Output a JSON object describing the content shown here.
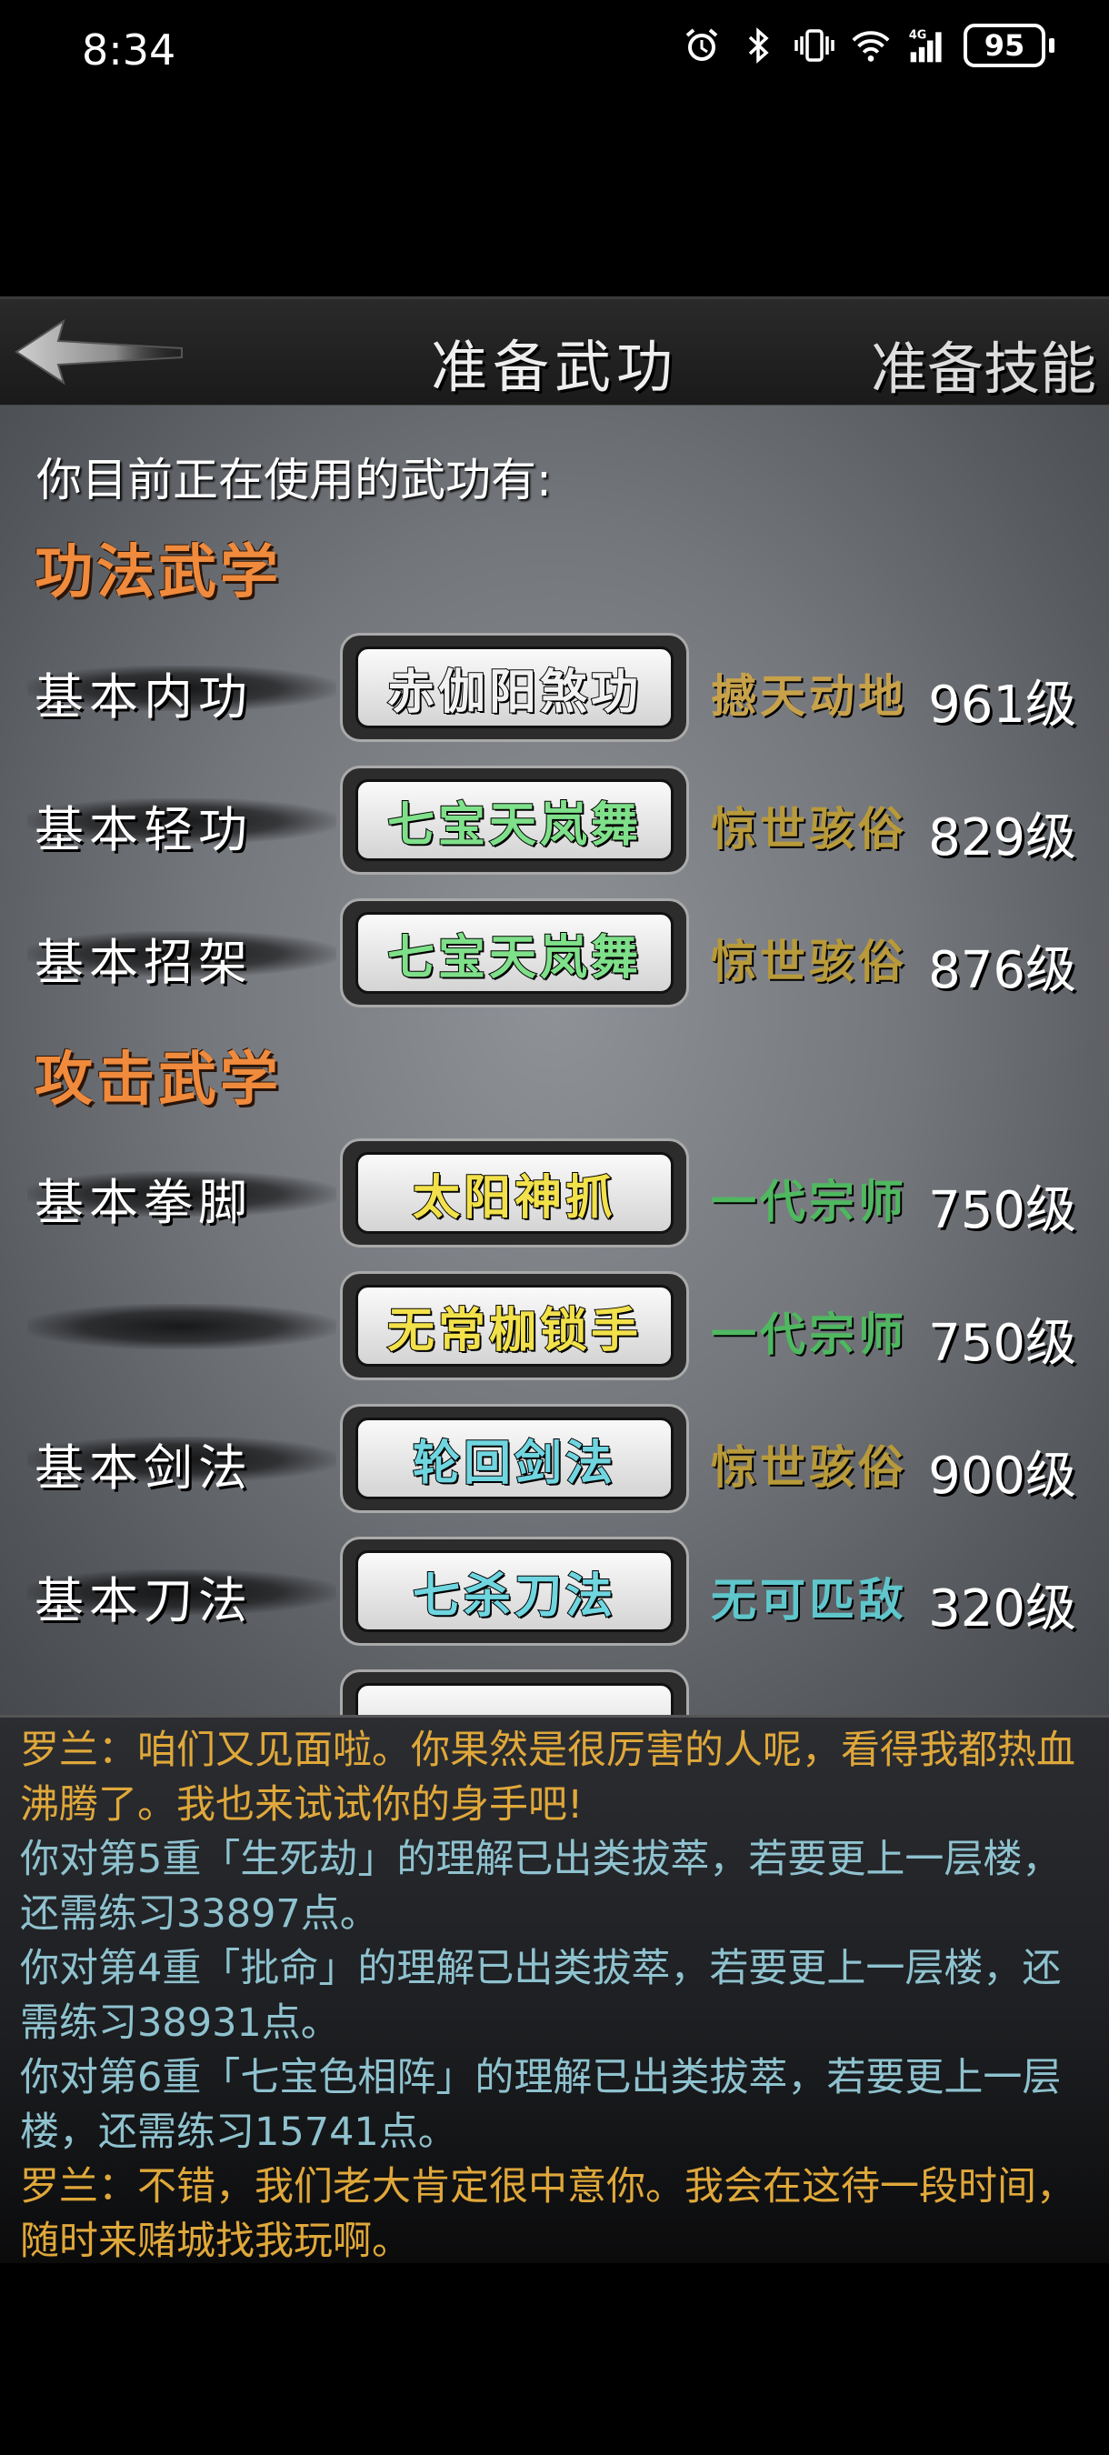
{
  "status_bar": {
    "time": "8:34",
    "battery": "95",
    "network": "4G"
  },
  "header": {
    "title": "准备武功",
    "right_tab": "准备技能"
  },
  "intro": "你目前正在使用的武功有:",
  "sections": {
    "neigong_title": "功法武学",
    "attack_title": "攻击武学"
  },
  "rows": [
    {
      "label": "基本内功",
      "skill": "赤伽阳煞功",
      "skill_color": "#f2f2f2",
      "rank": "撼天动地",
      "rank_color": "#c8a24a",
      "level": "961级"
    },
    {
      "label": "基本轻功",
      "skill": "七宝天岚舞",
      "skill_color": "#7fe08a",
      "rank": "惊世骇俗",
      "rank_color": "#b89a3a",
      "level": "829级"
    },
    {
      "label": "基本招架",
      "skill": "七宝天岚舞",
      "skill_color": "#7fe08a",
      "rank": "惊世骇俗",
      "rank_color": "#b89a3a",
      "level": "876级"
    },
    {
      "label": "基本拳脚",
      "skill": "太阳神抓",
      "skill_color": "#f2e14a",
      "rank": "一代宗师",
      "rank_color": "#4fb860",
      "level": "750级"
    },
    {
      "label": "",
      "skill": "无常枷锁手",
      "skill_color": "#f2e14a",
      "rank": "一代宗师",
      "rank_color": "#4fb860",
      "level": "750级"
    },
    {
      "label": "基本剑法",
      "skill": "轮回剑法",
      "skill_color": "#6fd6e0",
      "rank": "惊世骇俗",
      "rank_color": "#b89a3a",
      "level": "900级"
    },
    {
      "label": "基本刀法",
      "skill": "七杀刀法",
      "skill_color": "#6fd6e0",
      "rank": "无可匹敌",
      "rank_color": "#5fc6cc",
      "level": "320级"
    }
  ],
  "log": [
    {
      "text": "罗兰：咱们又见面啦。你果然是很厉害的人呢，看得我都热血沸腾了。我也来试试你的身手吧!",
      "color": "#e0a83a"
    },
    {
      "text": "你对第5重「生死劫」的理解已出类拔萃，若要更上一层楼，还需练习33897点。",
      "color": "#8fc2cf"
    },
    {
      "text": "你对第4重「批命」的理解已出类拔萃，若要更上一层楼，还需练习38931点。",
      "color": "#8fc2cf"
    },
    {
      "text": "你对第6重「七宝色相阵」的理解已出类拔萃，若要更上一层楼，还需练习15741点。",
      "color": "#8fc2cf"
    },
    {
      "text": "罗兰：不错，我们老大肯定很中意你。我会在这待一段时间，随时来赌城找我玩啊。",
      "color": "#e0a83a"
    }
  ]
}
